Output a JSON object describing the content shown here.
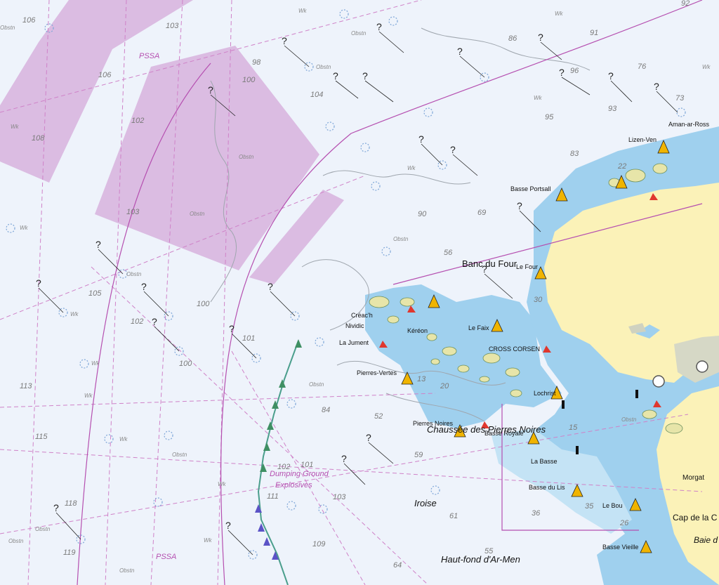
{
  "map": {
    "place_labels": {
      "banc_du_four": "Banc du Four",
      "chaussee": "Chaussée des Pierres Noires",
      "iroise": "Iroise",
      "haut_fond": "Haut-fond d'Ar-Men",
      "basse_portsall": "Basse Portsall",
      "le_four": "Le Four",
      "le_faix": "Le Faix",
      "cross_corsen": "CROSS CORSEN",
      "kereon": "Kéréon",
      "nividic": "Nividic",
      "la_jument": "La Jument",
      "pierres_vertes": "Pierres-Vertes",
      "creac": "Créac'h",
      "lochrist": "Lochrist",
      "basse_du_lis": "Basse du Lis",
      "le_bouchon": "Le Bouchon",
      "basse_vieille": "Basse Vieille",
      "cap_de_la_chevre": "Cap de la C",
      "baie": "Baie d",
      "morgat": "Morgat",
      "lizen_ven": "Lizen-Ven",
      "aman_ar_ross": "Aman-ar-Ross",
      "la_basse_rouge": "La Basse",
      "pierres_noires": "Pierres Noires",
      "basse_royale": "Basse Royale",
      "le_bouchon_short": "Le Bou"
    },
    "zone_labels": {
      "pssa_top": "PSSA",
      "pssa_bottom": "PSSA",
      "dumping": "Dumping Ground",
      "explosives": "Explosives"
    },
    "depth_labels": [
      "106",
      "103",
      "108",
      "106",
      "102",
      "103",
      "113",
      "115",
      "118",
      "119",
      "105",
      "102",
      "100",
      "100",
      "100",
      "104",
      "101",
      "98",
      "111",
      "102",
      "101",
      "103",
      "109",
      "64",
      "55",
      "90",
      "84",
      "86",
      "96",
      "95",
      "93",
      "92",
      "83",
      "73",
      "76",
      "91",
      "69",
      "56",
      "61",
      "52",
      "59",
      "35",
      "36",
      "26",
      "15",
      "13",
      "20",
      "30",
      "22"
    ],
    "obstn_text": "Obstn",
    "wk_text": "Wk",
    "colors": {
      "sea": "#eef3fb",
      "shallow": "#9fd0ee",
      "land": "#fbf2b8",
      "restricted": "#d7b2dd",
      "magenta": "#b54fb0",
      "track": "#7fa7d8"
    }
  }
}
